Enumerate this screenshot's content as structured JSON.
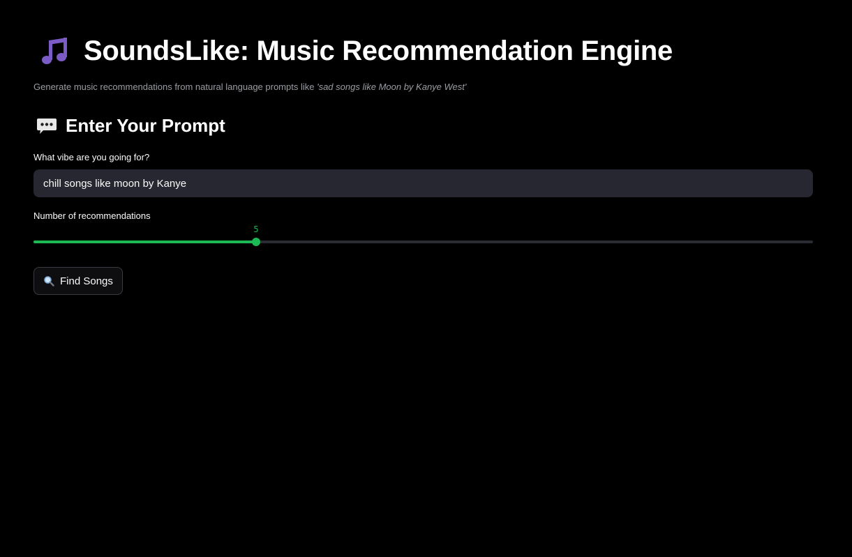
{
  "header": {
    "icon": "musical-notes-icon",
    "title": "SoundsLike: Music Recommendation Engine",
    "subtitle_prefix": "Generate music recommendations from natural language prompts like ",
    "subtitle_example": "'sad songs like Moon by Kanye West'"
  },
  "prompt_section": {
    "icon": "speech-balloon-icon",
    "title": "Enter Your Prompt",
    "input_label": "What vibe are you going for?",
    "input_value": "chill songs like moon by Kanye"
  },
  "slider": {
    "label": "Number of recommendations",
    "value": "5",
    "fill_fraction": 0.286
  },
  "actions": {
    "find_icon": "magnifier-icon",
    "find_label": "Find Songs"
  },
  "colors": {
    "background": "#000000",
    "accent": "#1db954",
    "input_bg": "#262730",
    "icon_purple": "#7b5cc6"
  }
}
